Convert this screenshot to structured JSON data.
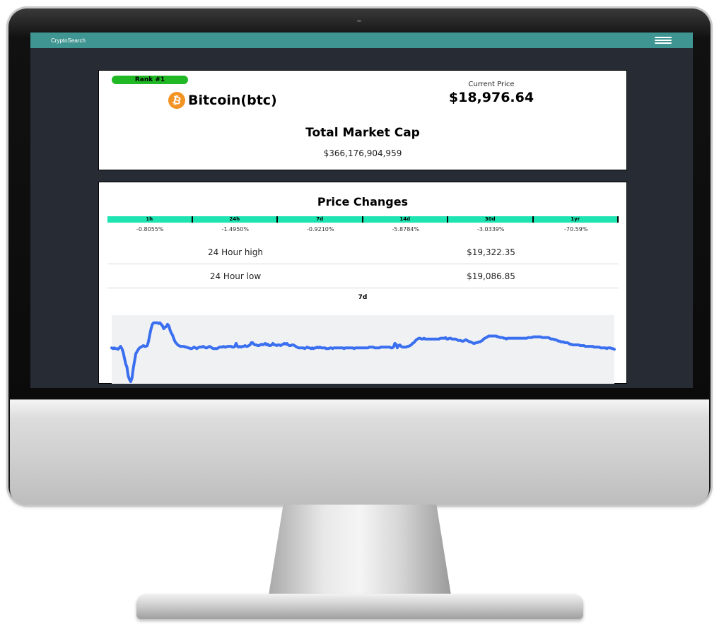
{
  "app": {
    "brand": "CryptoSearch"
  },
  "coin": {
    "rank_label": "Rank #1",
    "name": "Bitcoin(btc)",
    "icon": "bitcoin-icon",
    "current_price_label": "Current Price",
    "current_price": "$18,976.64",
    "market_cap_title": "Total Market Cap",
    "market_cap": "$366,176,904,959"
  },
  "price_changes": {
    "title": "Price Changes",
    "headers": [
      "1h",
      "24h",
      "7d",
      "14d",
      "30d",
      "1yr"
    ],
    "values": [
      "-0.8055%",
      "-1.4950%",
      "-0.9210%",
      "-5.8784%",
      "-3.0339%",
      "-70.59%"
    ]
  },
  "stats": {
    "high_label": "24 Hour high",
    "high_value": "$19,322.35",
    "low_label": "24 Hour low",
    "low_value": "$19,086.85"
  },
  "chart_data": {
    "type": "area",
    "title": "7d",
    "xlabel": "",
    "ylabel": "",
    "grid": false,
    "legend": false,
    "colors": {
      "line": "#3a6ff0",
      "fill": "#f0f1f3"
    },
    "ylim": [
      0,
      100
    ],
    "series": [
      {
        "values": [
          46,
          45,
          46,
          45,
          45,
          44,
          46,
          48,
          45,
          40,
          32,
          24,
          20,
          8,
          3,
          0,
          5,
          18,
          28,
          38,
          41,
          44,
          46,
          47,
          48,
          49,
          48,
          48,
          49,
          55,
          64,
          72,
          78,
          80,
          80,
          80,
          80,
          79,
          80,
          78,
          76,
          72,
          74,
          75,
          78,
          76,
          70,
          66,
          63,
          58,
          54,
          52,
          50,
          49,
          48,
          48,
          48,
          48,
          47,
          47,
          46,
          46,
          45,
          45,
          46,
          47,
          46,
          45,
          46,
          47,
          47,
          47,
          48,
          47,
          46,
          46,
          47,
          48,
          47,
          46,
          45,
          45,
          45,
          45,
          46,
          47,
          47,
          47,
          48,
          47,
          47,
          48,
          48,
          48,
          48,
          47,
          47,
          48,
          52,
          48,
          47,
          48,
          47,
          48,
          48,
          49,
          48,
          48,
          49,
          50,
          53,
          53,
          51,
          50,
          50,
          49,
          49,
          50,
          51,
          50,
          51,
          52,
          50,
          51,
          49,
          49,
          50,
          52,
          50,
          50,
          49,
          50,
          50,
          49,
          50,
          51,
          52,
          51,
          52,
          50,
          49,
          49,
          50,
          50,
          49,
          48,
          47,
          46,
          46,
          46,
          46,
          46,
          45,
          46,
          47,
          46,
          46,
          45,
          46,
          45,
          46,
          46,
          47,
          46,
          47,
          46,
          46,
          46,
          46,
          45,
          45,
          45,
          46,
          46,
          45,
          46,
          46,
          46,
          46,
          46,
          46,
          46,
          46,
          45,
          46,
          46,
          46,
          46,
          46,
          46,
          46,
          45,
          46,
          46,
          46,
          46,
          46,
          46,
          46,
          46,
          46,
          46,
          46,
          47,
          47,
          47,
          47,
          46,
          46,
          46,
          46,
          46,
          47,
          47,
          47,
          47,
          47,
          47,
          47,
          47,
          46,
          46,
          47,
          52,
          51,
          46,
          49,
          50,
          48,
          47,
          47,
          47,
          47,
          48,
          48,
          49,
          50,
          52,
          53,
          55,
          57,
          58,
          59,
          59,
          58,
          58,
          59,
          58,
          58,
          58,
          58,
          58,
          58,
          58,
          58,
          58,
          58,
          58,
          58,
          59,
          59,
          59,
          59,
          60,
          58,
          58,
          59,
          59,
          58,
          58,
          58,
          58,
          57,
          56,
          56,
          56,
          55,
          55,
          56,
          57,
          56,
          55,
          54,
          54,
          53,
          52,
          52,
          53,
          53,
          54,
          54,
          55,
          56,
          58,
          59,
          60,
          61,
          62,
          62,
          62,
          62,
          62,
          62,
          62,
          61,
          61,
          60,
          60,
          60,
          59,
          59,
          58,
          59,
          59,
          59,
          59,
          59,
          59,
          59,
          59,
          59,
          59,
          59,
          59,
          59,
          59,
          59,
          59,
          60,
          60,
          60,
          60,
          61,
          61,
          61,
          61,
          61,
          61,
          61,
          60,
          60,
          60,
          60,
          60,
          60,
          59,
          58,
          58,
          58,
          57,
          57,
          56,
          55,
          55,
          54,
          54,
          54,
          53,
          53,
          53,
          52,
          51,
          51,
          50,
          50,
          50,
          50,
          50,
          50,
          49,
          49,
          49,
          49,
          48,
          48,
          48,
          48,
          48,
          48,
          48,
          47,
          47,
          47,
          47,
          47,
          46,
          46,
          46,
          46,
          46,
          45,
          46,
          46,
          46,
          45,
          45,
          44
        ]
      }
    ]
  }
}
